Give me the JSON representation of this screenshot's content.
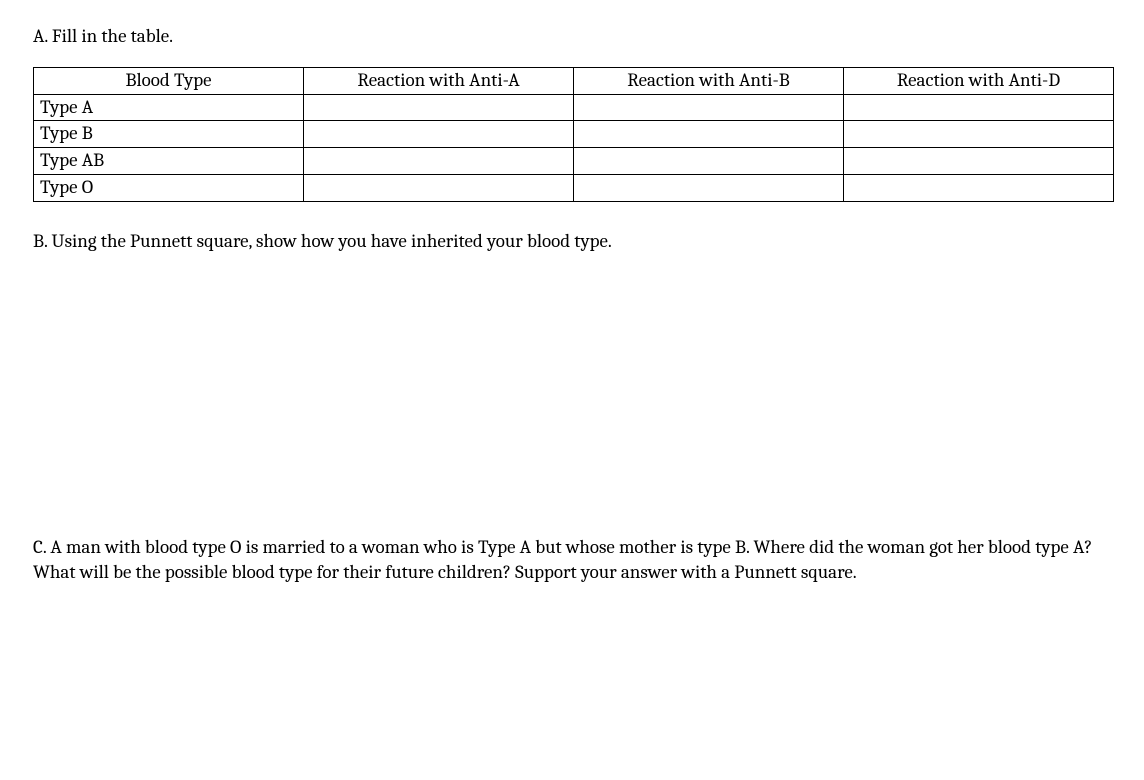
{
  "sectionA": {
    "heading": "A. Fill in the table.",
    "headers": {
      "col1": "Blood Type",
      "col2": "Reaction with Anti-A",
      "col3": "Reaction with Anti-B",
      "col4": "Reaction with Anti-D"
    },
    "rows": [
      {
        "label": "Type A",
        "c2": "",
        "c3": "",
        "c4": ""
      },
      {
        "label": "Type B",
        "c2": "",
        "c3": "",
        "c4": ""
      },
      {
        "label": "Type AB",
        "c2": "",
        "c3": "",
        "c4": ""
      },
      {
        "label": "Type O",
        "c2": "",
        "c3": "",
        "c4": ""
      }
    ]
  },
  "sectionB": {
    "heading": "B. Using the Punnett square, show how you have inherited your blood type."
  },
  "sectionC": {
    "text": "C. A man with blood type O is married to a woman who is Type A but whose mother is type B. Where did the woman got her blood type A? What will be the possible blood type for their future children? Support your answer with a Punnett square."
  }
}
